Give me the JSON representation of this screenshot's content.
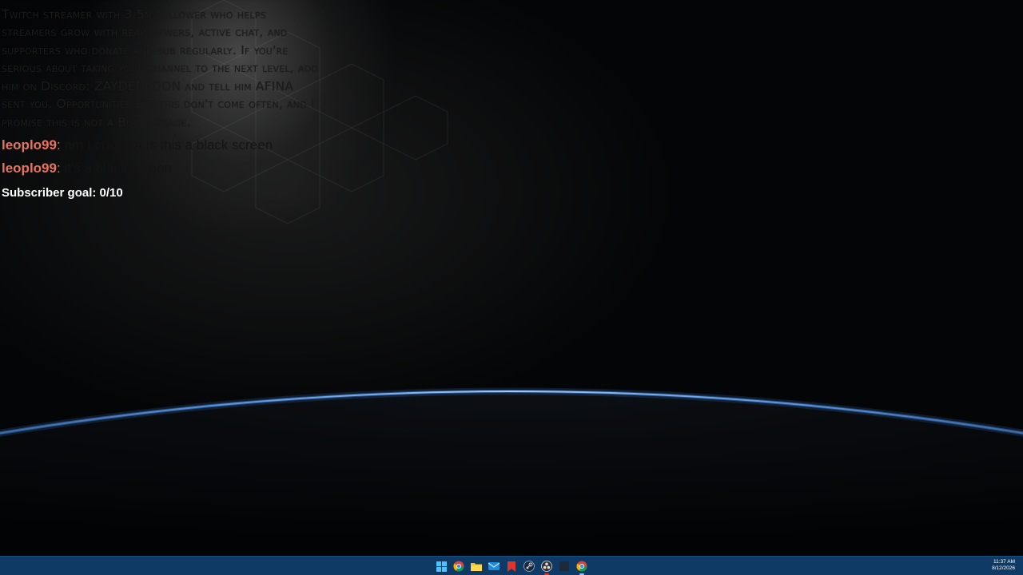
{
  "chat": {
    "bot_message": "Hello sorry i feel like hustle. I actually know a big Twitch streamer with 3.5m follower who helps streamers grow with real viewers, active chat, and supporters who donate and sub regularly. If you're serious about taking your channel to the next level, add him on Discord: ZAYDEN_OON and tell him AFINA sent you. Opportunities like this don't come often, and I promise this is not a Bot message.",
    "messages": [
      {
        "user": "leoplo99",
        "text": "am I crazy or is this a black screen"
      },
      {
        "user": "leoplo99",
        "text": "it's a black screen"
      }
    ],
    "subscriber_goal": "Subscriber goal: 0/10"
  },
  "taskbar": {
    "icons": [
      "windows-start-icon",
      "chrome-icon",
      "file-explorer-icon",
      "mail-icon",
      "red-app-icon",
      "steam-icon",
      "obs-icon",
      "dark-app-icon",
      "chrome-active-icon"
    ],
    "time": "11:37 AM",
    "date": "8/12/2026"
  },
  "colors": {
    "username": "#e8735d",
    "taskbar": "#0f3a66",
    "horizon_glow": "#5aa0ff"
  }
}
